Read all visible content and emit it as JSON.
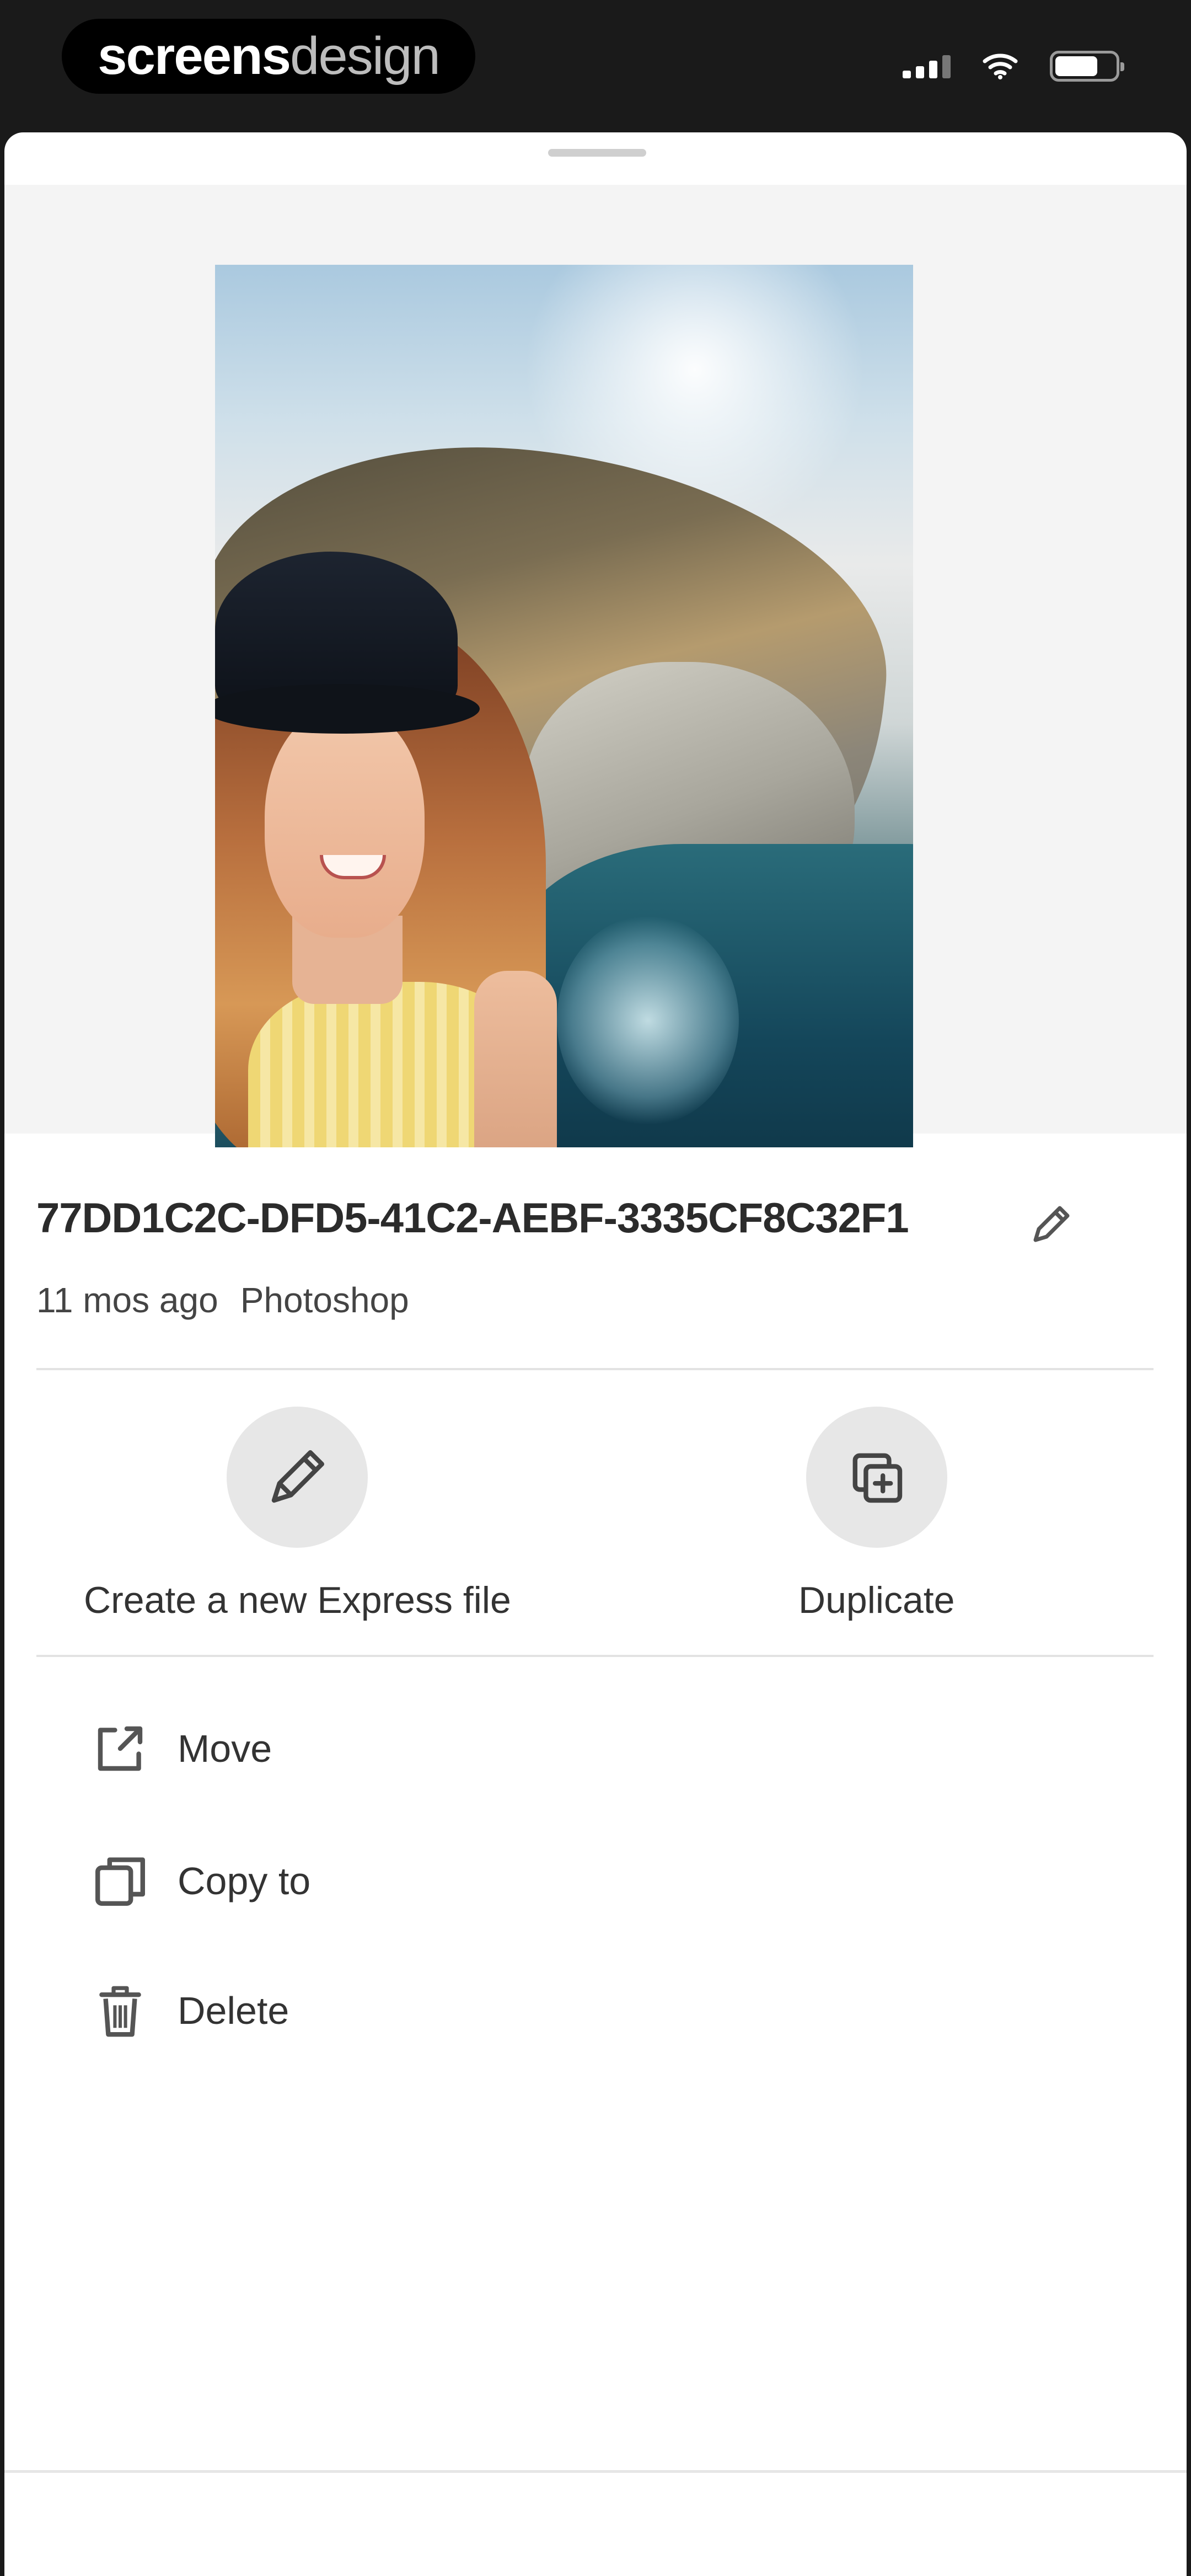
{
  "status_bar": {
    "brand_bold": "screens",
    "brand_light": "design"
  },
  "file": {
    "name": "77DD1C2C-DFD5-41C2-AEBF-3335CF8C32F1",
    "modified": "11 mos ago",
    "source_app": "Photoshop"
  },
  "actions": [
    {
      "label": "Create a new Express file",
      "icon": "pencil-icon"
    },
    {
      "label": "Duplicate",
      "icon": "duplicate-icon"
    }
  ],
  "menu": [
    {
      "label": "Move",
      "icon": "move-icon"
    },
    {
      "label": "Copy to",
      "icon": "copy-icon"
    },
    {
      "label": "Delete",
      "icon": "trash-icon"
    }
  ],
  "colors": {
    "sheet_background": "#ffffff",
    "preview_background": "#f4f4f4",
    "action_circle": "#e7e7e7",
    "text_primary": "#2b2b2b",
    "status_bar": "#1a1a1a"
  }
}
